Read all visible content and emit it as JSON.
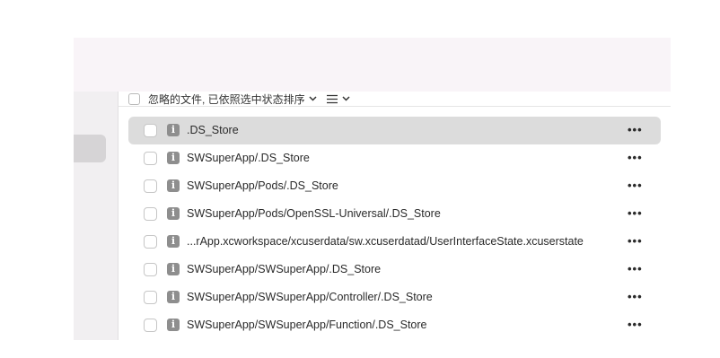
{
  "toolbar": {
    "sort_label": "忽略的文件, 已依照选中状态排序",
    "sort_chevron_icon": "chevron-down-icon",
    "list_icon": "list-icon"
  },
  "rows": [
    {
      "path": ".DS_Store",
      "selected": true
    },
    {
      "path": "SWSuperApp/.DS_Store",
      "selected": false
    },
    {
      "path": "SWSuperApp/Pods/.DS_Store",
      "selected": false
    },
    {
      "path": "SWSuperApp/Pods/OpenSSL-Universal/.DS_Store",
      "selected": false
    },
    {
      "path": "...rApp.xcworkspace/xcuserdata/sw.xcuserdatad/UserInterfaceState.xcuserstate",
      "selected": false
    },
    {
      "path": "SWSuperApp/SWSuperApp/.DS_Store",
      "selected": false
    },
    {
      "path": "SWSuperApp/SWSuperApp/Controller/.DS_Store",
      "selected": false
    },
    {
      "path": "SWSuperApp/SWSuperApp/Function/.DS_Store",
      "selected": false
    }
  ],
  "row_more_label": "•••",
  "row_info_label": "i"
}
